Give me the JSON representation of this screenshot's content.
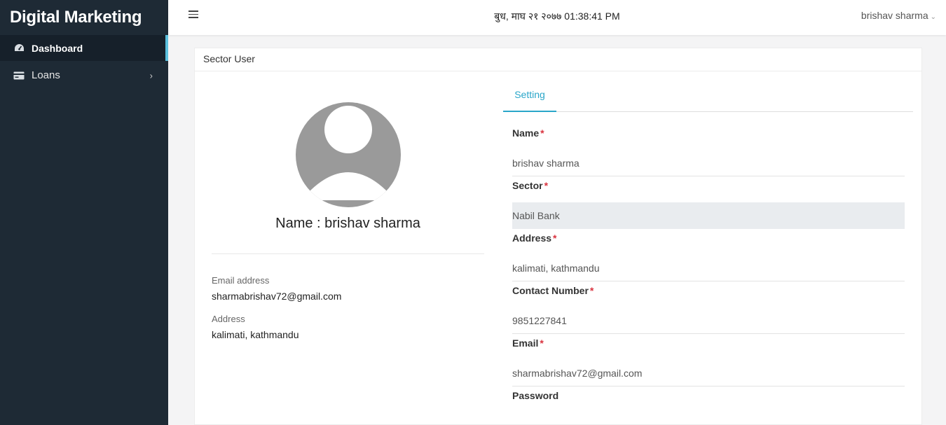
{
  "sidebar": {
    "brand": "Digital Marketing",
    "items": [
      {
        "label": "Dashboard",
        "icon": "dashboard-icon"
      },
      {
        "label": "Loans",
        "icon": "card-icon"
      }
    ]
  },
  "topbar": {
    "datetime": "बुध, माघ २१ २०७७ 01:38:41 PM",
    "user": "brishav sharma"
  },
  "card": {
    "title": "Sector User"
  },
  "profile": {
    "name": "Name : brishav sharma",
    "email_label": "Email address",
    "email": "sharmabrishav72@gmail.com",
    "address_label": "Address",
    "address": "kalimati, kathmandu"
  },
  "settings": {
    "tab": "Setting",
    "name_label": "Name",
    "name_value": "brishav sharma",
    "sector_label": "Sector",
    "sector_value": "Nabil Bank",
    "address_label": "Address",
    "address_value": "kalimati, kathmandu",
    "contact_label": "Contact Number",
    "contact_value": "9851227841",
    "email_label": "Email",
    "email_value": "sharmabrishav72@gmail.com",
    "password_label": "Password",
    "required_mark": "*"
  },
  "colors": {
    "sidebar": "#1e2a35",
    "accent": "#2aa6c9",
    "required": "#d9333f"
  }
}
